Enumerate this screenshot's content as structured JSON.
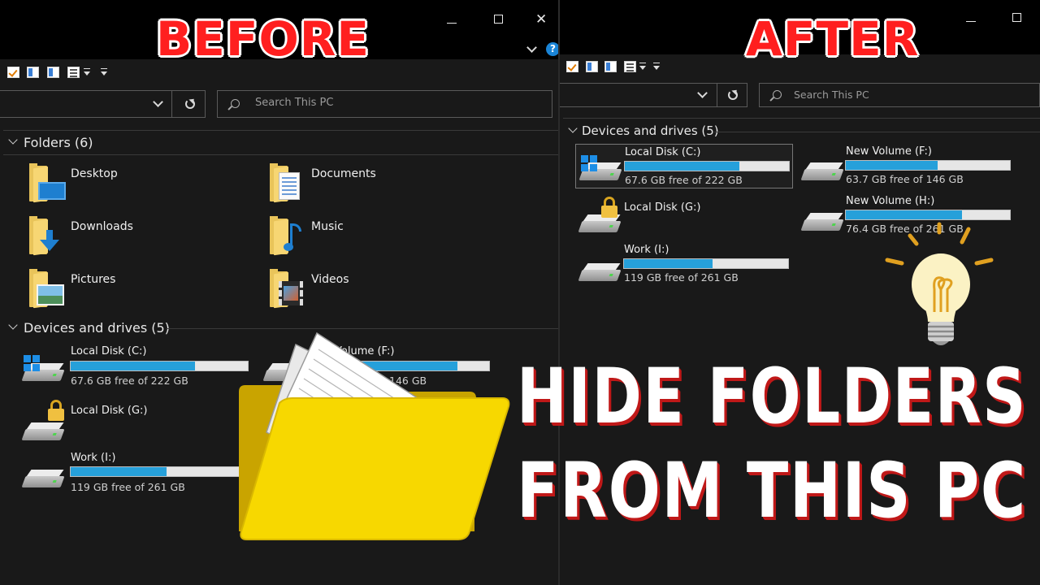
{
  "before": {
    "label": "BEFORE",
    "window_controls": {
      "minimize": "minimize",
      "maximize": "maximize",
      "close": "✕"
    },
    "help": "?",
    "search_placeholder": "Search This PC",
    "folders_header": "Folders (6)",
    "folders": [
      {
        "label": "Desktop",
        "icon": "desktop-folder-icon"
      },
      {
        "label": "Documents",
        "icon": "documents-folder-icon"
      },
      {
        "label": "Downloads",
        "icon": "downloads-folder-icon"
      },
      {
        "label": "Music",
        "icon": "music-folder-icon"
      },
      {
        "label": "Pictures",
        "icon": "pictures-folder-icon"
      },
      {
        "label": "Videos",
        "icon": "videos-folder-icon"
      }
    ],
    "drives_header": "Devices and drives (5)",
    "drives": [
      {
        "name": "Local Disk (C:)",
        "free": "67.6 GB free of 222 GB",
        "used_fraction": 0.7
      },
      {
        "name": "Local Disk (G:)",
        "free": "",
        "used_fraction": null
      },
      {
        "name": "Work (I:)",
        "free": "119 GB free of 261 GB",
        "used_fraction": 0.54
      }
    ],
    "partial_drive": {
      "name": "Volume (F:)",
      "free": "146 GB"
    }
  },
  "after": {
    "label": "AFTER",
    "window_controls": {
      "minimize": "minimize",
      "maximize": "maximize"
    },
    "search_placeholder": "Search This PC",
    "drives_header": "Devices and drives (5)",
    "drives": [
      {
        "name": "Local Disk (C:)",
        "free": "67.6 GB free of 222 GB",
        "used_fraction": 0.7
      },
      {
        "name": "New Volume (F:)",
        "free": "63.7 GB free of 146 GB",
        "used_fraction": 0.56
      },
      {
        "name": "Local Disk (G:)",
        "free": "",
        "used_fraction": null
      },
      {
        "name": "New Volume (H:)",
        "free": "76.4 GB free of 261 GB",
        "used_fraction": 0.71
      },
      {
        "name": "Work (I:)",
        "free": "119 GB free of 261 GB",
        "used_fraction": 0.54
      }
    ]
  },
  "headline": {
    "line1": "HIDE FOLDERS",
    "line2": "FROM THIS PC"
  },
  "colors": {
    "bar_fill": "#26a0da",
    "label_red": "#ff1f1f",
    "headline_shadow": "#c01818",
    "folder_yellow": "#f7d800"
  }
}
